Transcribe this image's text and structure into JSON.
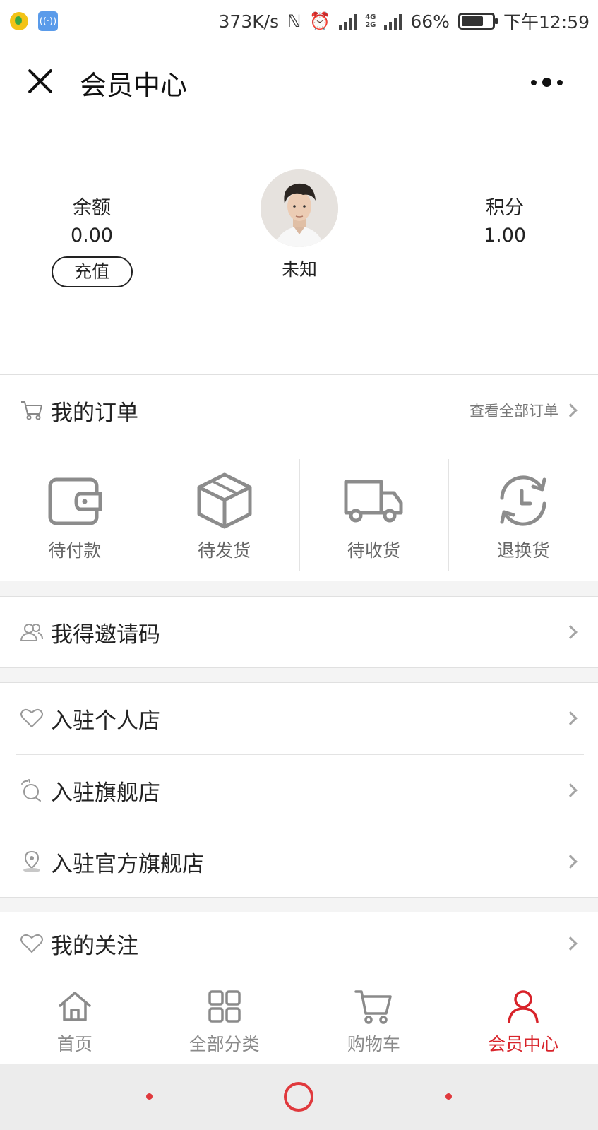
{
  "status_bar": {
    "speed": "373K/s",
    "net_top": "4G",
    "net_bottom": "2G",
    "battery": "66%",
    "battery_level": 0.66,
    "time": "下午12:59"
  },
  "header": {
    "title": "会员中心"
  },
  "profile": {
    "balance_label": "余额",
    "balance_value": "0.00",
    "recharge_label": "充值",
    "nickname": "未知",
    "points_label": "积分",
    "points_value": "1.00"
  },
  "orders": {
    "title": "我的订单",
    "view_all": "查看全部订单",
    "statuses": [
      {
        "label": "待付款",
        "icon": "wallet-icon"
      },
      {
        "label": "待发货",
        "icon": "box-icon"
      },
      {
        "label": "待收货",
        "icon": "truck-icon"
      },
      {
        "label": "退换货",
        "icon": "exchange-icon"
      }
    ]
  },
  "menu": {
    "invite_code": "我得邀请码",
    "personal_store": "入驻个人店",
    "flagship_store": "入驻旗舰店",
    "official_flagship": "入驻官方旗舰店",
    "my_follow": "我的关注"
  },
  "tabbar": {
    "items": [
      {
        "label": "首页",
        "icon": "home-icon"
      },
      {
        "label": "全部分类",
        "icon": "grid-icon"
      },
      {
        "label": "购物车",
        "icon": "cart-icon"
      },
      {
        "label": "会员中心",
        "icon": "user-icon",
        "active": true
      }
    ]
  },
  "colors": {
    "accent": "#d8232a",
    "nav_red": "#e0393d"
  }
}
